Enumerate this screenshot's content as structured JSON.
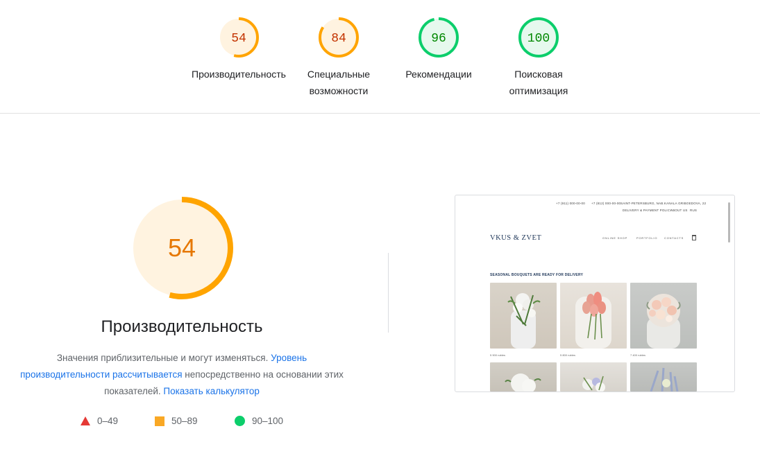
{
  "summary": {
    "items": [
      {
        "score": "54",
        "label": "Производительность",
        "score_value": 54,
        "color": "#ffa400",
        "fill": "#fff3e0",
        "text_color": "#c33300"
      },
      {
        "score": "84",
        "label": "Специальные возможности",
        "score_value": 84,
        "color": "#ffa400",
        "fill": "#fff3e0",
        "text_color": "#c33300"
      },
      {
        "score": "96",
        "label": "Рекомендации",
        "score_value": 96,
        "color": "#0cce6b",
        "fill": "#e6f9ee",
        "text_color": "#008800"
      },
      {
        "score": "100",
        "label": "Поисковая оптимизация",
        "score_value": 100,
        "color": "#0cce6b",
        "fill": "#e6f9ee",
        "text_color": "#008800"
      }
    ]
  },
  "performance": {
    "score": "54",
    "score_value": 54,
    "title": "Производительность",
    "color": "#ffa400",
    "fill": "#fff3e0",
    "text_color": "#e67700",
    "desc_1": "Значения приблизительные и могут изменяться. ",
    "desc_link_1": "Уровень производительности рассчитывается",
    "desc_2": " непосредственно на основании этих показателей. ",
    "desc_link_2": "Показать калькулятор"
  },
  "legend": {
    "fail": "0–49",
    "average": "50–89",
    "pass": "90–100"
  },
  "preview": {
    "phone_1": "+7 (911) 000-00-00",
    "phone_2": "+7 (812) 000-00-00",
    "address": "SAINT-PETERSBURG, NAB.KANALA GRIBOEDOVA, 22",
    "link_delivery": "DELIVERY & PAYMENT POLICY",
    "link_about": "ABOUT US",
    "link_lang": "RUS",
    "logo": "VKUS & ZVET",
    "nav": [
      "ONLINE SHOP",
      "PORTFOLIO",
      "CONTACTS"
    ],
    "headline": "SEASONAL BOUQUETS ARE READY FOR DELIVERY",
    "prices": [
      "5 900 rubles",
      "5 800 rubles",
      "7 400 rubles"
    ]
  }
}
